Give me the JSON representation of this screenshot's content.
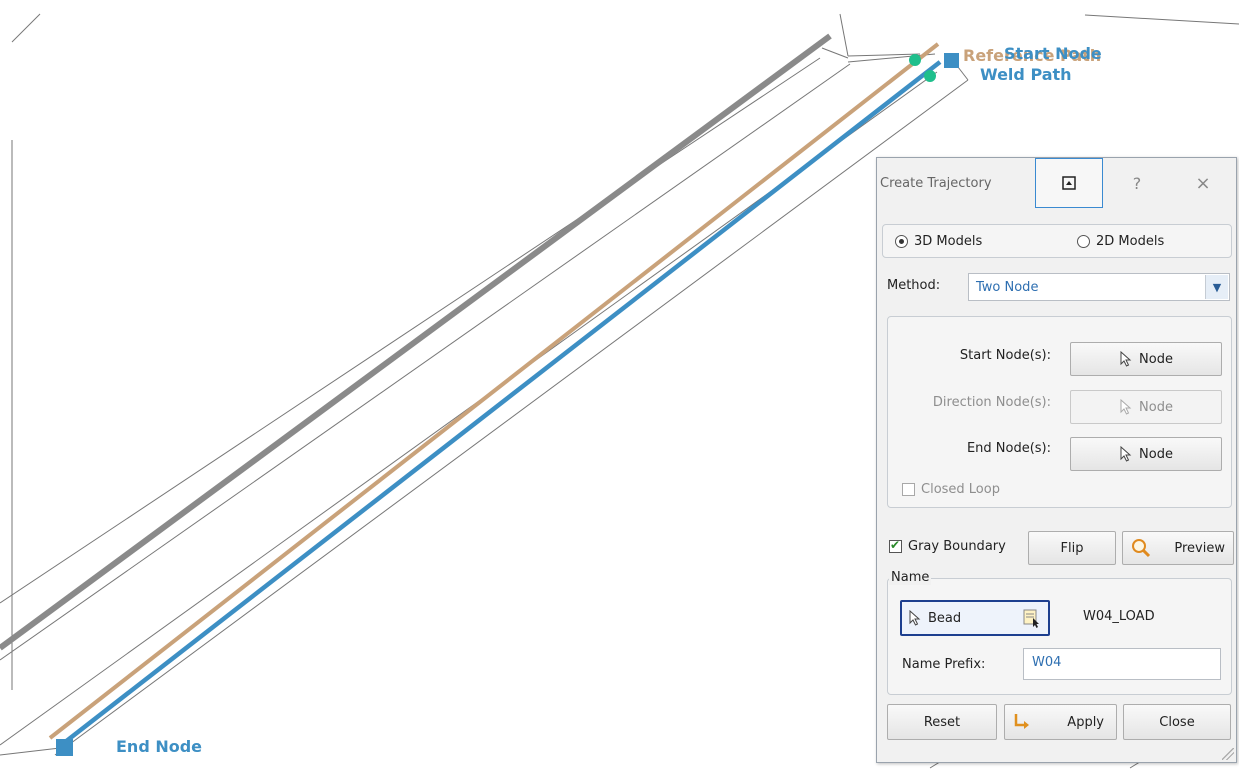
{
  "viewport": {
    "start_label": "Start Node",
    "reference_label": "Reference Path",
    "weld_label": "Weld Path",
    "end_label": "End Node",
    "colors": {
      "reference": "#c9a27a",
      "weld": "#3d8fc4",
      "boundary": "#8a8a8a",
      "node": "#3d8fc4",
      "marker": "#1fbf8c"
    }
  },
  "dialog": {
    "title": "Create Trajectory",
    "help_label": "?",
    "close_icon_label": "×",
    "model_options": {
      "option_3d": "3D Models",
      "option_2d": "2D Models",
      "selected": "3D Models"
    },
    "method": {
      "label": "Method:",
      "value": "Two Node"
    },
    "nodes": {
      "start_label": "Start Node(s):",
      "start_button": "Node",
      "direction_label": "Direction Node(s):",
      "direction_button": "Node",
      "end_label": "End Node(s):",
      "end_button": "Node",
      "closed_loop": "Closed Loop"
    },
    "gray_boundary": "Gray Boundary",
    "flip_button": "Flip",
    "preview_button": "Preview",
    "name_group": {
      "legend": "Name",
      "bead_button": "Bead",
      "name_value": "W04_LOAD",
      "prefix_label": "Name Prefix:",
      "prefix_value": "W04"
    },
    "reset_button": "Reset",
    "apply_button": "Apply",
    "close_button": "Close"
  }
}
